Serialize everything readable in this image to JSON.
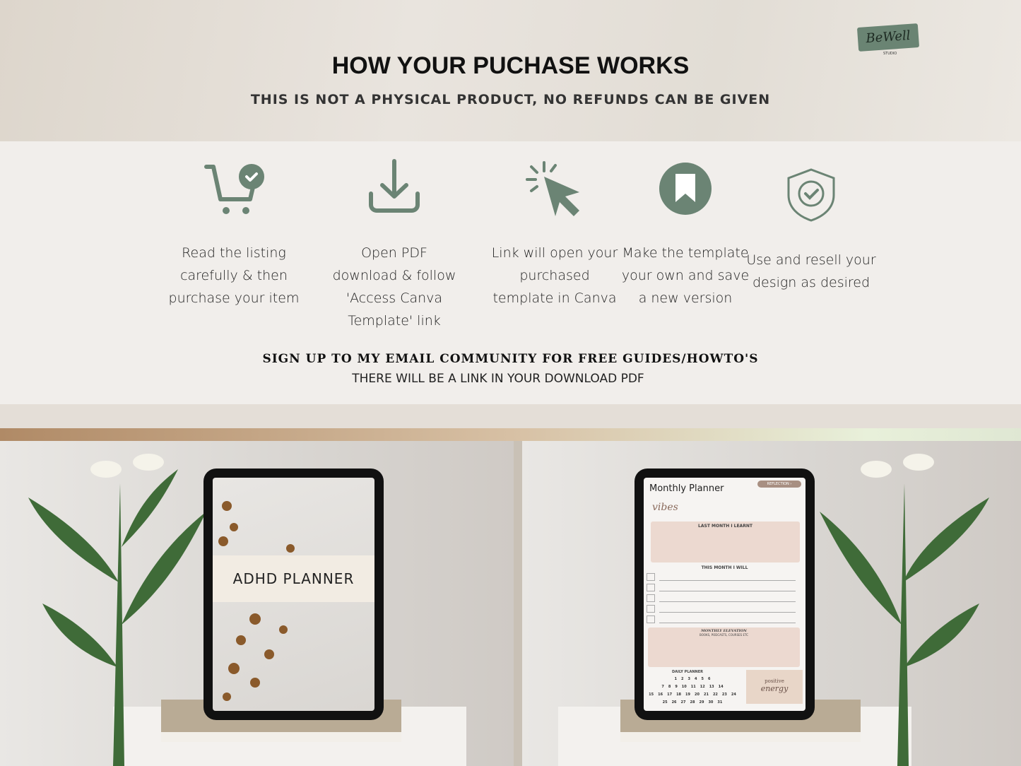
{
  "header": {
    "title": "HOW YOUR PUCHASE WORKS",
    "subtitle": "THIS IS NOT A PHYSICAL PRODUCT, NO REFUNDS CAN BE GIVEN",
    "logo_text": "BeWell",
    "logo_sub": "STUDIO"
  },
  "accent_color": "#6b8474",
  "steps": [
    {
      "icon": "cart-check-icon",
      "text": "Read the listing carefully & then purchase your item"
    },
    {
      "icon": "download-icon",
      "text": "Open PDF download & follow 'Access Canva Template' link"
    },
    {
      "icon": "cursor-click-icon",
      "text": "Link will open your purchased template in Canva"
    },
    {
      "icon": "bookmark-icon",
      "text": "Make the template your own and save a new version"
    },
    {
      "icon": "shield-check-icon",
      "text": "Use and resell your design as desired"
    }
  ],
  "signup": {
    "headline": "SIGN UP TO MY EMAIL COMMUNITY FOR FREE GUIDES/HOWTO'S",
    "note": "THERE WILL BE A LINK IN YOUR DOWNLOAD PDF"
  },
  "left_tablet": {
    "cover_title": "ADHD PLANNER"
  },
  "right_tablet": {
    "title": "Monthly Planner",
    "reflection": "REFLECTION",
    "vibes": "vibes",
    "last_month": "LAST MONTH I LEARNT",
    "this_month": "THIS MONTH I WILL",
    "elevation": "MONTHLY ELEVATION",
    "elevation_sub": "BOOKS, PODCASTS, COURSES ETC",
    "daily": "DAILY PLANNER",
    "positive": "positive",
    "energy": "energy",
    "calendar": [
      [
        "1",
        "2",
        "3",
        "4",
        "5",
        "6"
      ],
      [
        "7",
        "8",
        "9",
        "10",
        "11",
        "12",
        "13",
        "14"
      ],
      [
        "15",
        "16",
        "17",
        "18",
        "19",
        "20",
        "21",
        "22",
        "23",
        "24"
      ],
      [
        "25",
        "26",
        "27",
        "28",
        "29",
        "30",
        "31"
      ]
    ]
  }
}
